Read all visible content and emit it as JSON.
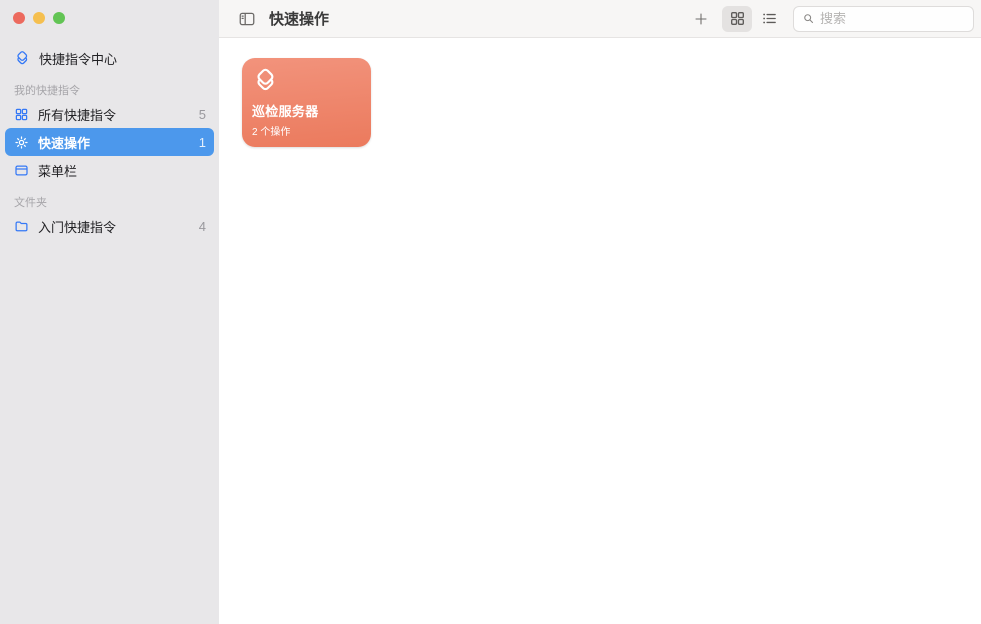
{
  "colors": {
    "accent_blue": "#3478F6",
    "selection_blue": "#4C98EC",
    "sidebar_bg": "#E8E7E9",
    "toolbar_bg": "#F7F6F5",
    "card_gradient_top": "#F2937C",
    "card_gradient_bottom": "#EB7A5D",
    "traffic_red": "#EC6A5E",
    "traffic_yellow": "#F5BF4F",
    "traffic_green": "#62C454"
  },
  "sidebar": {
    "shortcuts_center": {
      "label": "快捷指令中心",
      "icon": "shortcuts-layers-icon"
    },
    "sections": [
      {
        "header": "我的快捷指令",
        "items": [
          {
            "label": "所有快捷指令",
            "count": "5",
            "icon": "grid-icon",
            "selected": false
          },
          {
            "label": "快速操作",
            "count": "1",
            "icon": "gear-icon",
            "selected": true
          },
          {
            "label": "菜单栏",
            "icon": "menubar-icon",
            "selected": false
          }
        ]
      },
      {
        "header": "文件夹",
        "items": [
          {
            "label": "入门快捷指令",
            "count": "4",
            "icon": "folder-icon",
            "selected": false
          }
        ]
      }
    ]
  },
  "toolbar": {
    "title": "快速操作",
    "search": {
      "placeholder": "搜索"
    }
  },
  "content": {
    "shortcuts": [
      {
        "name": "巡检服务器",
        "meta": "2 个操作"
      }
    ]
  }
}
